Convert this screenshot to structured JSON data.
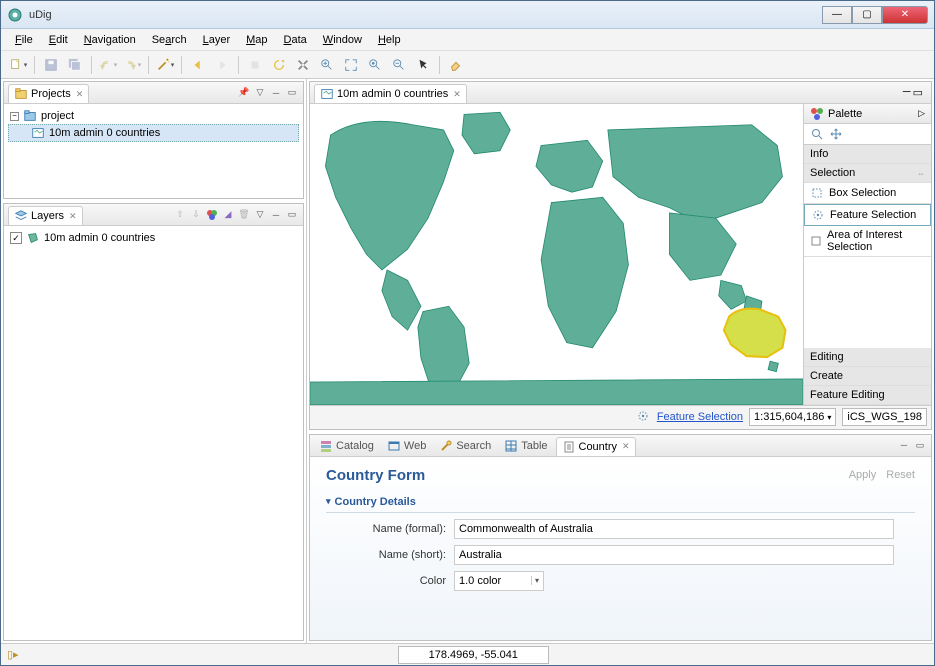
{
  "window": {
    "title": "uDig"
  },
  "menu": {
    "file": "File",
    "edit": "Edit",
    "navigation": "Navigation",
    "search": "Search",
    "layer": "Layer",
    "map": "Map",
    "data": "Data",
    "window": "Window",
    "help": "Help"
  },
  "views": {
    "projects": {
      "title": "Projects",
      "root": "project",
      "child": "10m admin 0 countries"
    },
    "layers": {
      "title": "Layers",
      "layer0": "10m admin 0 countries",
      "layer0_checked": true
    }
  },
  "editor": {
    "tab": "10m admin 0 countries",
    "tool_link": "Feature Selection",
    "scale": "1:315,604,186",
    "crs": "iCS_WGS_198"
  },
  "palette": {
    "title": "Palette",
    "info": "Info",
    "selection": "Selection",
    "box_sel": "Box Selection",
    "feat_sel": "Feature Selection",
    "aoi_sel": "Area of Interest Selection",
    "editing": "Editing",
    "create": "Create",
    "feat_edit": "Feature Editing"
  },
  "bottom": {
    "tabs": {
      "catalog": "Catalog",
      "web": "Web",
      "search": "Search",
      "table": "Table",
      "country": "Country"
    },
    "form_title": "Country Form",
    "apply": "Apply",
    "reset": "Reset",
    "section": "Country Details",
    "name_formal_label": "Name (formal):",
    "name_formal_value": "Commonwealth of Australia",
    "name_short_label": "Name (short):",
    "name_short_value": "Australia",
    "color_label": "Color",
    "color_value": "1.0 color"
  },
  "status": {
    "coords": "178.4969, -55.041"
  }
}
